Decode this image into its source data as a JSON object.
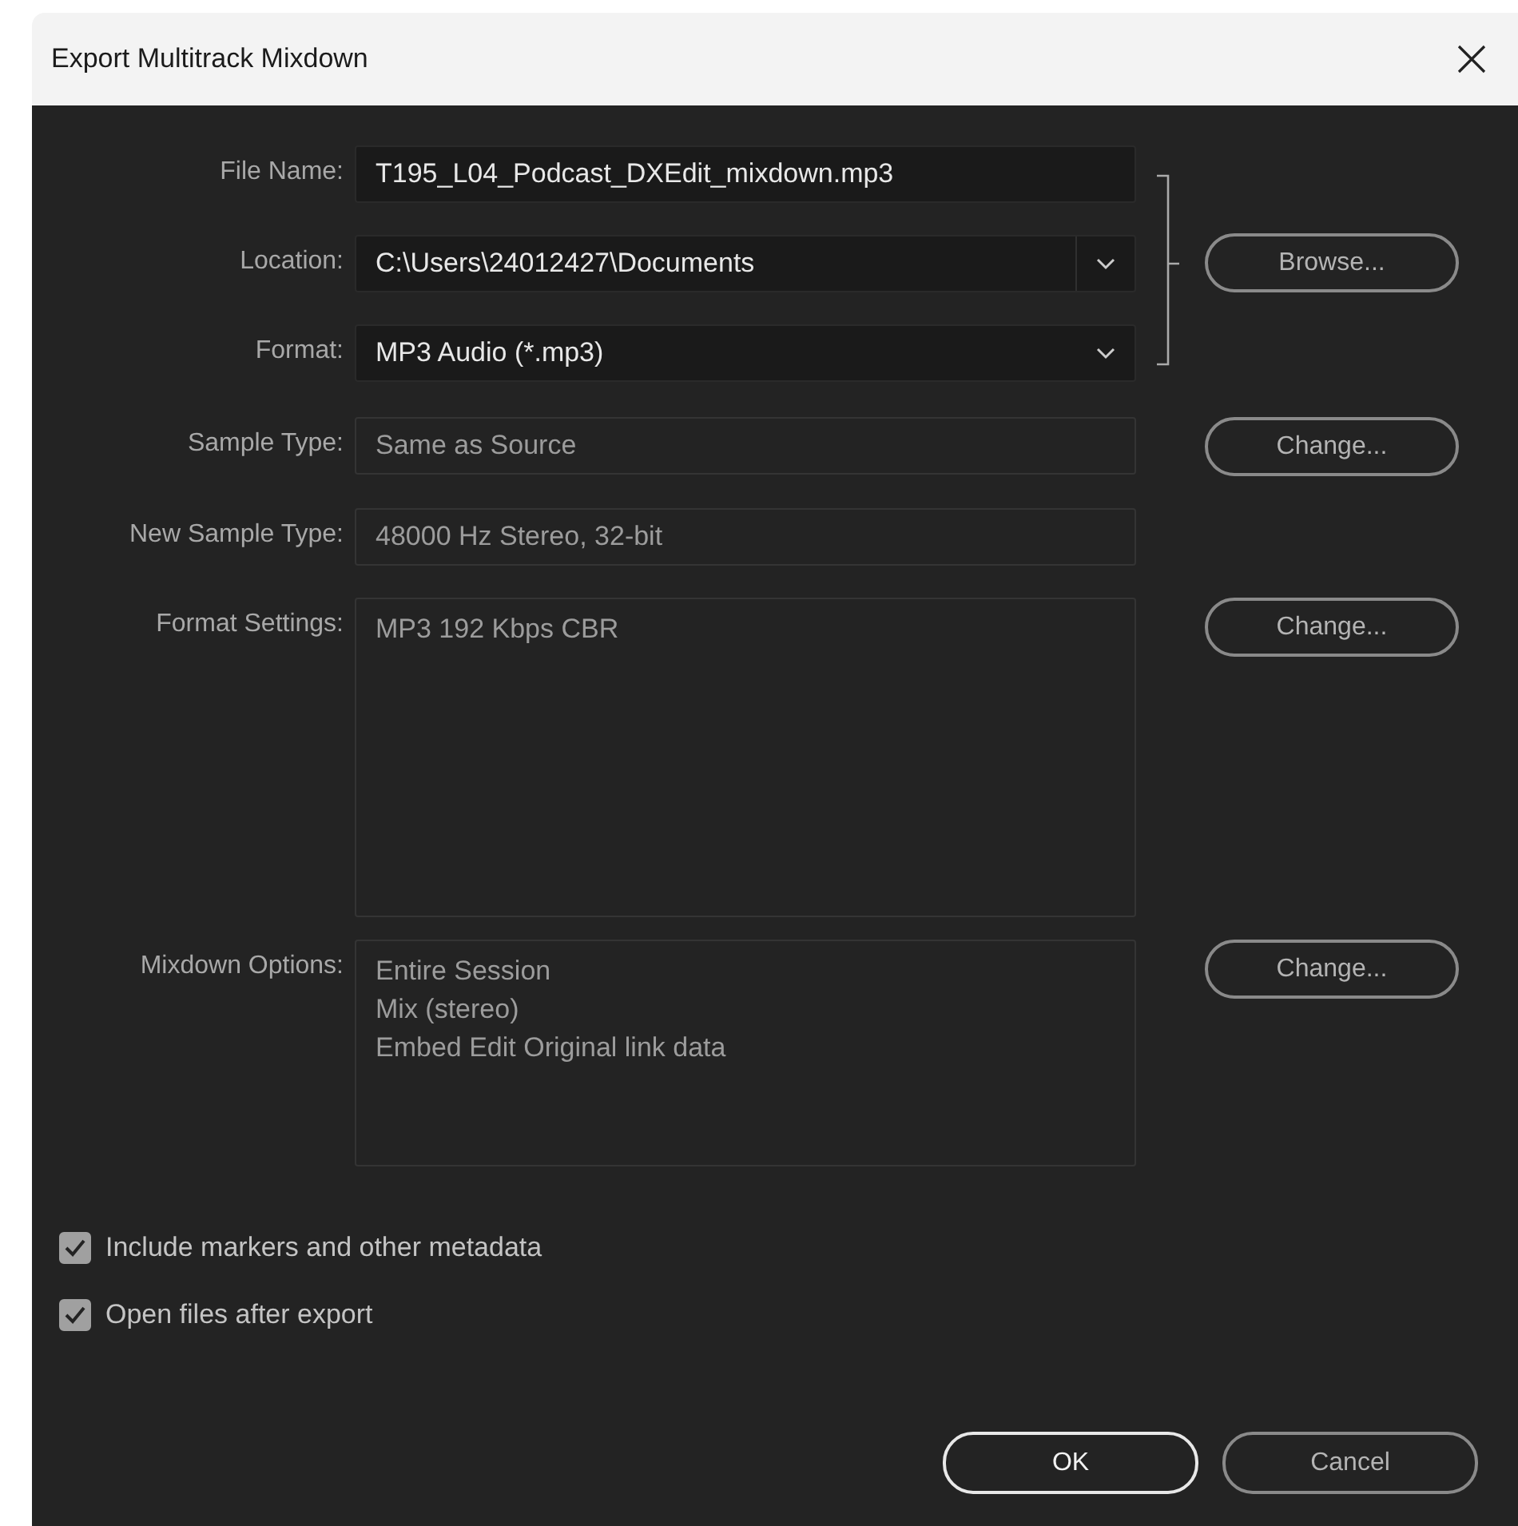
{
  "window": {
    "title": "Export Multitrack Mixdown"
  },
  "destination": {
    "fields": [
      {
        "label": "File Name:",
        "kind": "text",
        "value": "T195_L04_Podcast_DXEdit_mixdown.mp3",
        "disabled": false
      },
      {
        "label": "Location:",
        "kind": "combo",
        "value": "C:\\Users\\24012427\\Documents",
        "disabled": false
      },
      {
        "label": "Format:",
        "kind": "dropdown",
        "value": "MP3 Audio (*.mp3)",
        "disabled": false
      }
    ],
    "button": "Browse..."
  },
  "settings": [
    {
      "label": "Sample Type:",
      "kind": "text",
      "value": "Same as Source",
      "disabled": true,
      "button": "Change..."
    },
    {
      "label": "New Sample Type:",
      "kind": "text",
      "value": "48000 Hz Stereo, 32-bit",
      "disabled": true
    },
    {
      "label": "Format Settings:",
      "kind": "multiline",
      "lines": [
        "MP3 192 Kbps CBR"
      ],
      "disabled": true,
      "button": "Change..."
    },
    {
      "label": "Mixdown Options:",
      "kind": "multiline",
      "lines": [
        "Entire Session",
        "Mix (stereo)",
        "Embed Edit Original link data"
      ],
      "disabled": true,
      "button": "Change..."
    }
  ],
  "options": [
    {
      "label": "Include markers and other metadata",
      "checked": true
    },
    {
      "label": "Open files after export",
      "checked": true
    }
  ],
  "buttons": [
    {
      "label": "OK",
      "default": true
    },
    {
      "label": "Cancel",
      "default": false
    }
  ]
}
